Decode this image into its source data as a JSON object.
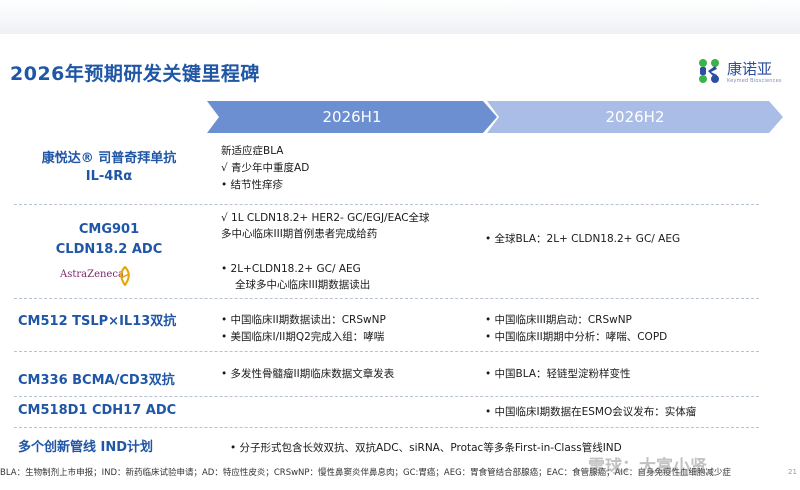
{
  "title": "2026年预期研发关键里程碑",
  "logo": {
    "name": "康诺亚",
    "sub": "Keymed Biosciences",
    "icon": "keymed-logo-icon",
    "colors": [
      "#3eb24a",
      "#2b4ea2"
    ]
  },
  "timeline": {
    "h1": "2026H1",
    "h2": "2026H2",
    "colors": {
      "h1": "#6b8fd0",
      "h2": "#a9bde6"
    }
  },
  "rows": [
    {
      "label_lines": [
        "康悦达® 司普奇拜单抗",
        "IL-4Rα"
      ],
      "h1": [
        "新适应症BLA",
        "√  青少年中重度AD",
        "•   结节性痒疹"
      ],
      "h2": []
    },
    {
      "label_lines": [
        "CMG901",
        "CLDN18.2 ADC"
      ],
      "partner": "AstraZeneca",
      "h1": [
        "√ 1L CLDN18.2+ HER2-  GC/EGJ/EAC全球",
        "多中心临床III期首例患者完成给药",
        "•   2L+CLDN18.2+ GC/ AEG",
        "全球多中心临床III期数据读出"
      ],
      "h2": [
        "•   全球BLA：2L+ CLDN18.2+ GC/ AEG"
      ]
    },
    {
      "label_lines": [
        "CM512  TSLP×IL13双抗"
      ],
      "h1": [
        "•   中国临床II期数据读出：CRSwNP",
        "•   美国临床I/II期Q2完成入组：哮喘"
      ],
      "h2": [
        "•   中国临床III期启动：CRSwNP",
        "•   中国临床II期期中分析：哮喘、COPD"
      ]
    },
    {
      "label_lines": [
        "CM336  BCMA/CD3双抗"
      ],
      "h1": [
        "•   多发性骨髓瘤II期临床数据文章发表"
      ],
      "h2": [
        "•   中国BLA：轻链型淀粉样变性"
      ]
    },
    {
      "label_lines": [
        "CM518D1  CDH17 ADC"
      ],
      "h1": [],
      "h2": [
        "•   中国临床I期数据在ESMO会议发布：实体瘤"
      ]
    },
    {
      "label_lines": [
        "多个创新管线 IND计划"
      ],
      "h1": [
        "•   分子形式包含长效双抗、双抗ADC、siRNA、Protac等多条First-in-Class管线IND"
      ],
      "h2": []
    }
  ],
  "footer": "BLA：生物制剂上市申报；IND：新药临床试验申请；AD：特应性皮炎；CRSwNP：慢性鼻窦炎伴鼻息肉；GC:胃癌；AEG：胃食管结合部腺癌；EAC：食管腺癌；AIC：自身免疫性血细胞减少症",
  "watermark": "雪球：大富小贤",
  "page_number": "21"
}
